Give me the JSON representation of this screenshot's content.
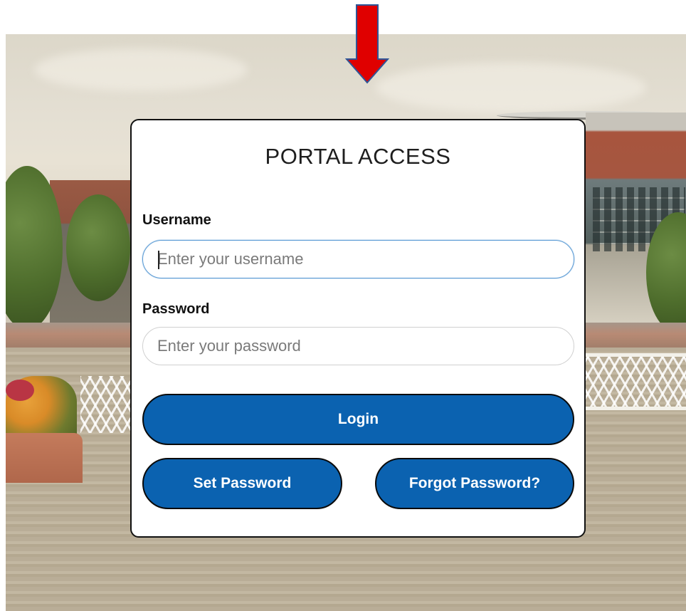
{
  "login_card": {
    "title": "PORTAL ACCESS",
    "username": {
      "label": "Username",
      "placeholder": "Enter your username"
    },
    "password": {
      "label": "Password",
      "placeholder": "Enter your password"
    },
    "login_button": "Login",
    "set_password_button": "Set Password",
    "forgot_password_button": "Forgot Password?"
  },
  "colors": {
    "button_blue": "#0b62b0",
    "arrow_red": "#e00000",
    "arrow_outline": "#2f5597",
    "focus_border": "#5b9bd5"
  },
  "icons": {
    "annotation": "red-down-arrow"
  }
}
